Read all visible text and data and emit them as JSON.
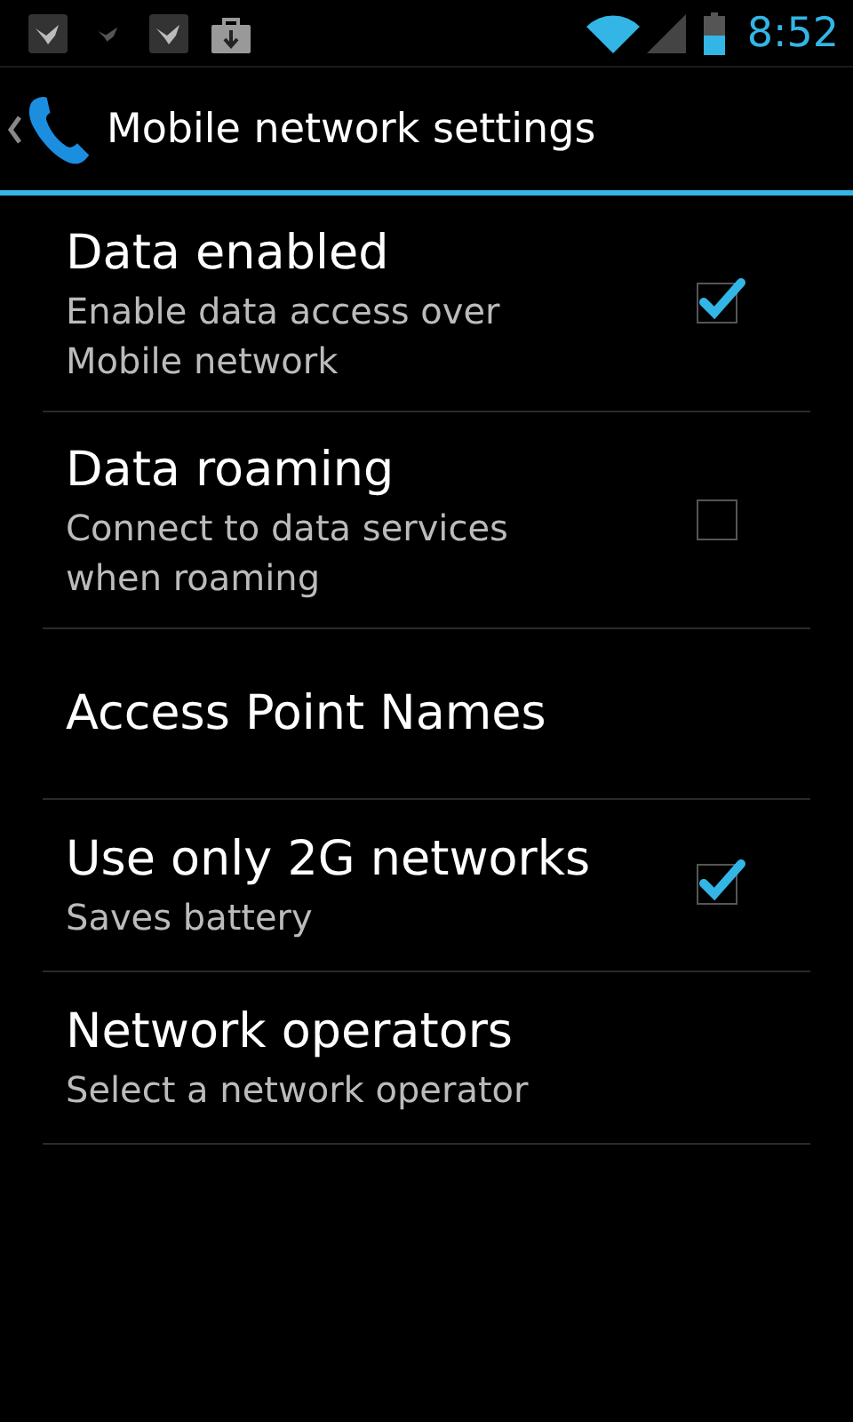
{
  "status_bar": {
    "time": "8:52"
  },
  "action_bar": {
    "title": "Mobile network settings"
  },
  "settings": [
    {
      "kind": "checkbox",
      "title": "Data enabled",
      "summary": "Enable data access over Mobile network",
      "checked": true
    },
    {
      "kind": "checkbox",
      "title": "Data roaming",
      "summary": "Connect to data services when roaming",
      "checked": false
    },
    {
      "kind": "plain",
      "title": "Access Point Names"
    },
    {
      "kind": "checkbox",
      "title": "Use only 2G networks",
      "summary": "Saves battery",
      "checked": true
    },
    {
      "kind": "plain",
      "title": "Network operators",
      "summary": "Select a network operator"
    }
  ]
}
